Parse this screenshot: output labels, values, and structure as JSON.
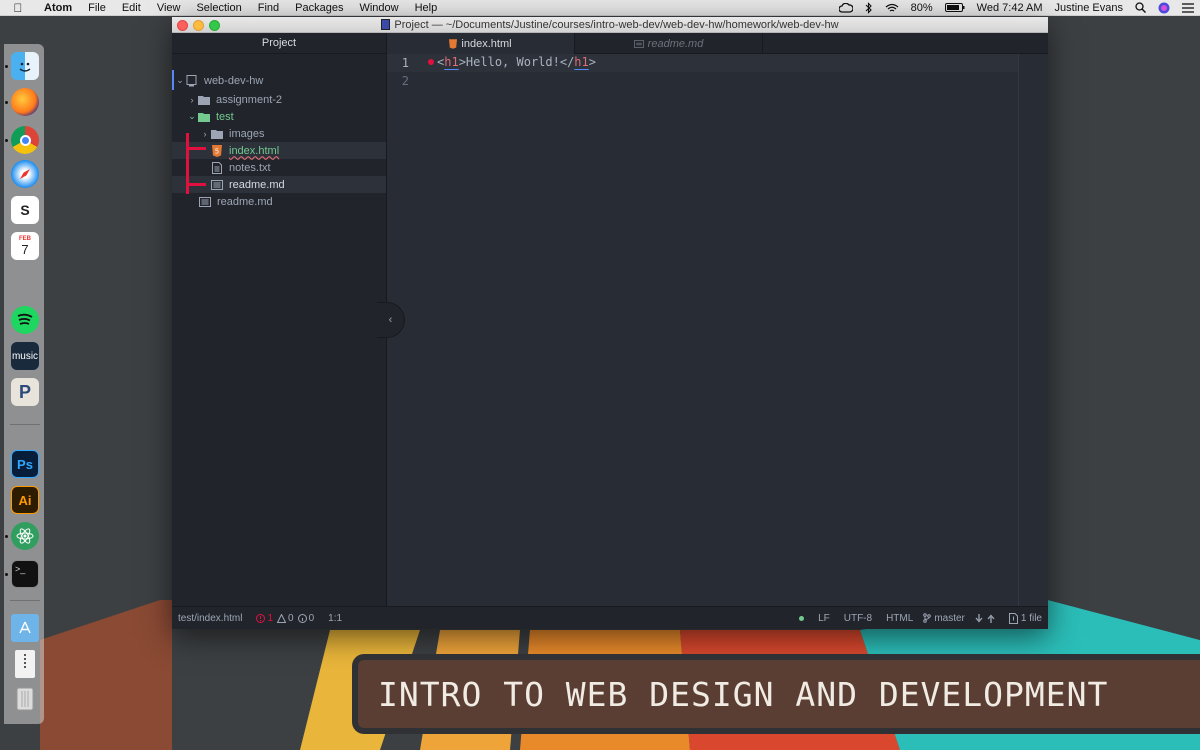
{
  "menubar": {
    "app_name": "Atom",
    "items": [
      "File",
      "Edit",
      "View",
      "Selection",
      "Find",
      "Packages",
      "Window",
      "Help"
    ],
    "battery": "80%",
    "clock": "Wed 7:42 AM",
    "user": "Justine Evans"
  },
  "dock": {
    "apps": [
      "finder",
      "firefox",
      "chrome",
      "safari",
      "slack",
      "calendar",
      "spotify",
      "amazon-music",
      "pandora",
      "photoshop",
      "illustrator",
      "atom",
      "terminal",
      "applications-folder",
      "archive",
      "trash"
    ],
    "calendar_month": "FEB",
    "calendar_day": "7",
    "music_label": "music",
    "photoshop_label": "Ps",
    "illustrator_label": "Ai"
  },
  "window": {
    "title": "Project — ~/Documents/Justine/courses/intro-web-dev/web-dev-hw/homework/web-dev-hw"
  },
  "tree": {
    "header": "Project",
    "root": "web-dev-hw",
    "items": [
      {
        "label": "assignment-2",
        "type": "folder",
        "expanded": false
      },
      {
        "label": "test",
        "type": "folder",
        "expanded": true
      },
      {
        "label": "images",
        "type": "folder",
        "expanded": false
      },
      {
        "label": "index.html",
        "type": "html-file"
      },
      {
        "label": "notes.txt",
        "type": "text-file"
      },
      {
        "label": "readme.md",
        "type": "markdown-file"
      },
      {
        "label": "readme.md",
        "type": "markdown-file"
      }
    ]
  },
  "tabs": [
    {
      "label": "index.html",
      "active": true
    },
    {
      "label": "readme.md",
      "active": false
    }
  ],
  "editor": {
    "line_numbers": [
      "1",
      "2"
    ],
    "code_open_bracket": "<",
    "code_tag": "h1",
    "code_close_bracket": ">",
    "code_text": "Hello, World!",
    "code_end_open": "</",
    "code_end_tag": "h1",
    "code_end_close": ">"
  },
  "status": {
    "file_path": "test/index.html",
    "errors": "1",
    "warnings": "0",
    "infos": "0",
    "cursor": "1:1",
    "line_ending": "LF",
    "encoding": "UTF-8",
    "grammar": "HTML",
    "branch": "master",
    "changed_files": "1 file"
  },
  "banner": {
    "text": "INTRO TO WEB DESIGN AND DEVELOPMENT"
  },
  "colors": {
    "accent_green": "#73c990",
    "error_red": "#e0103f",
    "tag_red": "#e06c75",
    "html_icon_orange": "#e37933"
  }
}
